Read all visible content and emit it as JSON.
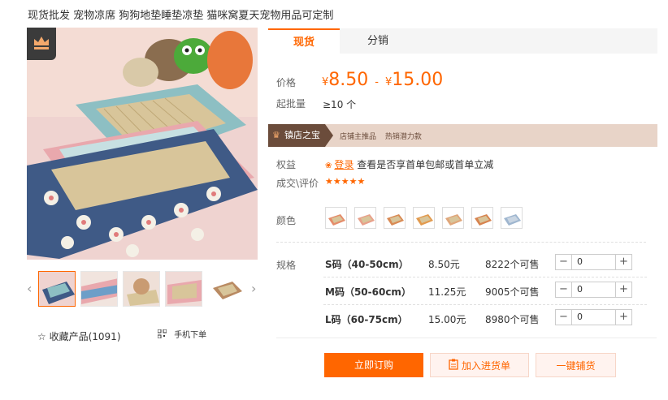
{
  "title": "现货批发 宠物凉席 狗狗地垫睡垫凉垫 猫咪窝夏天宠物用品可定制",
  "gallery": {
    "fav_label": "收藏产品(1091)",
    "mobile_label": "手机下单"
  },
  "tabs": [
    {
      "label": "现货"
    },
    {
      "label": "分销"
    }
  ],
  "labels": {
    "price": "价格",
    "moq": "起批量",
    "benefit": "权益",
    "rating": "成交\\评价",
    "color": "颜色",
    "spec": "规格"
  },
  "price": {
    "currency": "¥",
    "low": "8.50",
    "dash": "-",
    "high": "15.00"
  },
  "moq_value": "≥10 个",
  "shopbar": {
    "tag": "镇店之宝",
    "item1": "店铺主推品",
    "item2": "热销潜力款"
  },
  "benefit": {
    "login": "登录",
    "text": "查看是否享首单包邮或首单立减"
  },
  "rating_stars": "★★★★★",
  "skus": [
    {
      "name": "S码（40-50cm）",
      "price": "8.50元",
      "stock": "8222个可售",
      "qty": "0"
    },
    {
      "name": "M码（50-60cm）",
      "price": "11.25元",
      "stock": "9005个可售",
      "qty": "0"
    },
    {
      "name": "L码（60-75cm）",
      "price": "15.00元",
      "stock": "8980个可售",
      "qty": "0"
    }
  ],
  "stepper": {
    "minus": "−",
    "plus": "+"
  },
  "actions": {
    "buy": "立即订购",
    "cart": "加入进货单",
    "one_click": "一键铺货"
  },
  "colors": {
    "accent": "#ff6600",
    "shopbar_bg": "#e8d4c8",
    "shopbar_tag": "#6b4c3b"
  }
}
